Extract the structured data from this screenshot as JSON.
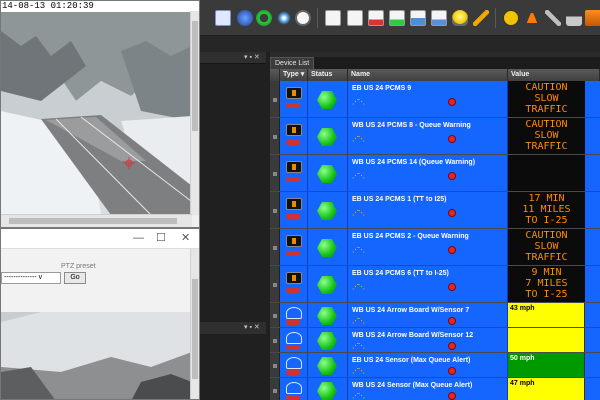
{
  "camera_window_1": {
    "timestamp": "14-08-13 01:20:39"
  },
  "camera_window_2": {
    "preset_label": "PTZ preset",
    "preset_select_value": "-------------- v",
    "go_label": "Go"
  },
  "device_list": {
    "tab_label": "Device List",
    "columns": {
      "type": "Type",
      "status": "Status",
      "name": "Name",
      "value": "Value"
    },
    "rows": [
      {
        "name": "EB US 24 PCMS 9",
        "type": "sign",
        "status": "online",
        "value_kind": "sign",
        "value": "CAUTION\nSLOW\nTRAFFIC"
      },
      {
        "name": "WB US 24 PCMS 8 - Queue Warning",
        "type": "sign",
        "status": "online",
        "value_kind": "sign",
        "value": "CAUTION\nSLOW\nTRAFFIC"
      },
      {
        "name": "WB US 24 PCMS 14 (Queue Warning)",
        "type": "sign",
        "status": "online",
        "value_kind": "sign",
        "value": ""
      },
      {
        "name": "EB US 24 PCMS 1 (TT to I25)",
        "type": "sign",
        "status": "online",
        "value_kind": "sign",
        "value": "17 MIN\n11 MILES\nTO I-25"
      },
      {
        "name": "EB US 24 PCMS 2 - Queue Warning",
        "type": "sign",
        "status": "online",
        "value_kind": "sign",
        "value": "CAUTION\nSLOW\nTRAFFIC"
      },
      {
        "name": "EB US 24 PCMS 6 (TT to I-25)",
        "type": "sign",
        "status": "online",
        "value_kind": "sign",
        "value": "9 MIN\n7 MILES\nTO I-25"
      },
      {
        "name": "WB US 24 Arrow Board W/Sensor 7",
        "type": "sensor",
        "status": "online",
        "value_kind": "speed",
        "value": "43 mph",
        "value_color": "#ffff00"
      },
      {
        "name": "WB US 24 Arrow Board W/Sensor 12",
        "type": "sensor",
        "status": "online",
        "value_kind": "speed",
        "value": "",
        "value_color": "#ffff00"
      },
      {
        "name": "EB US 24 Sensor (Max Queue Alert)",
        "type": "sensor",
        "status": "online",
        "value_kind": "speed",
        "value": "50 mph",
        "value_color": "#009900"
      },
      {
        "name": "WB US 24 Sensor (Max Queue Alert)",
        "type": "sensor",
        "status": "online",
        "value_kind": "speed",
        "value": "47 mph",
        "value_color": "#ffff00"
      }
    ]
  },
  "colors": {
    "row_blue": "#1565ff",
    "sign_text": "#ff8c00",
    "status_green": "#16c316",
    "speed_yellow": "#ffff00",
    "speed_green": "#009900"
  },
  "icons": {
    "toolbar": [
      "chart-icon",
      "globe-icon",
      "refresh-icon",
      "star-icon",
      "clock-icon",
      "document-icon",
      "document-edit-icon",
      "document-alert-icon",
      "document-add-icon",
      "document-image-icon",
      "document-info-icon",
      "lightbulb-icon",
      "tools-icon",
      "warning-icon",
      "cone-icon",
      "wrench-icon",
      "lock-icon",
      "stack-icon"
    ]
  }
}
